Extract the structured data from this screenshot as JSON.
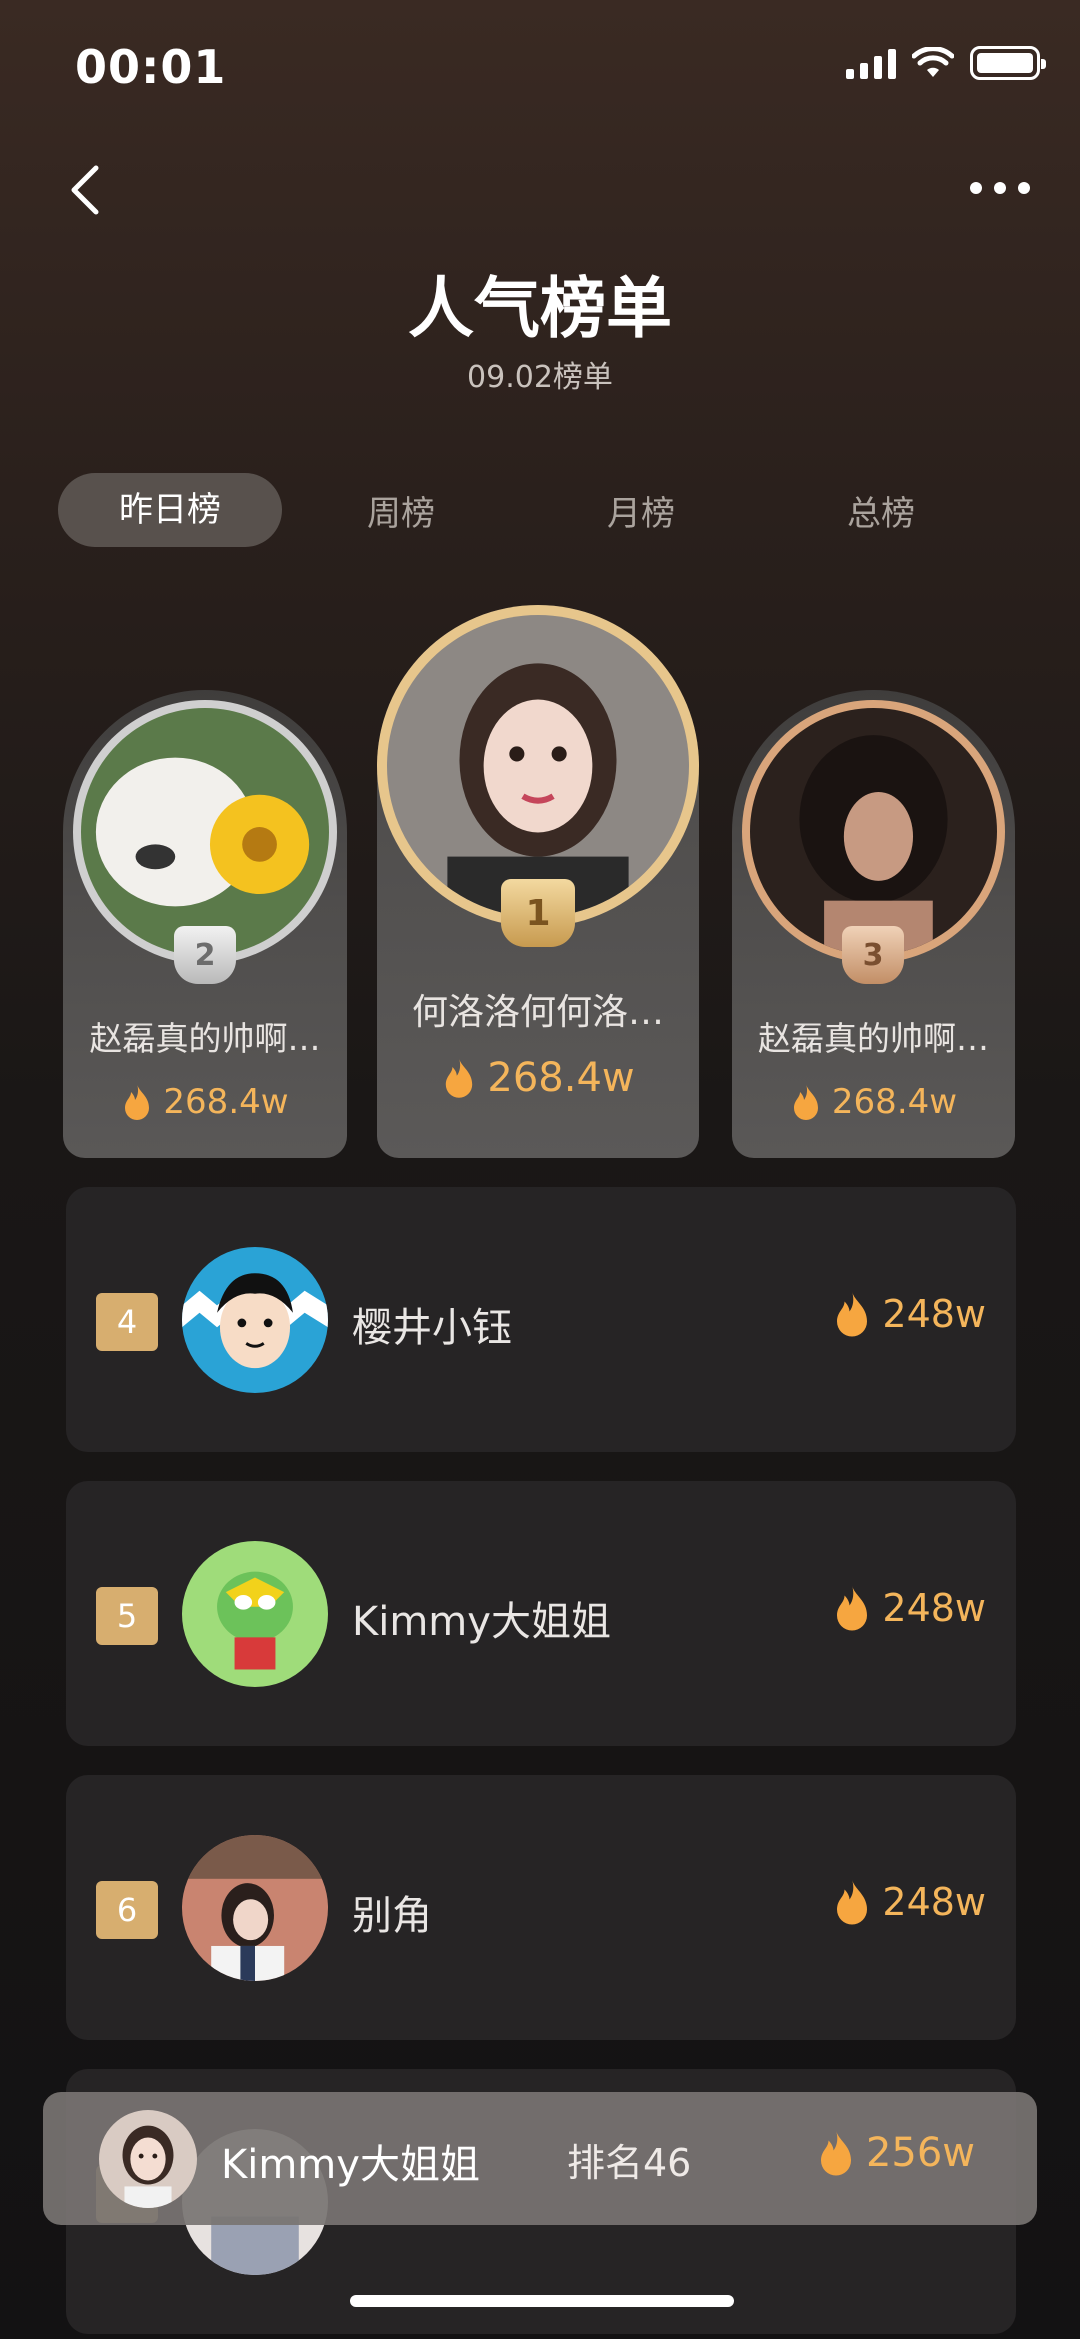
{
  "status": {
    "time": "00:01"
  },
  "header": {
    "title": "人气榜单",
    "subtitle": "09.02榜单"
  },
  "tabs": [
    {
      "label": "昨日榜",
      "active": true
    },
    {
      "label": "周榜",
      "active": false
    },
    {
      "label": "月榜",
      "active": false
    },
    {
      "label": "总榜",
      "active": false
    }
  ],
  "podium": [
    {
      "rank": "1",
      "name": "何洛洛何何洛…",
      "score": "268.4w"
    },
    {
      "rank": "2",
      "name": "赵磊真的帅啊…",
      "score": "268.4w"
    },
    {
      "rank": "3",
      "name": "赵磊真的帅啊…",
      "score": "268.4w"
    }
  ],
  "list": [
    {
      "rank": "4",
      "name": "樱井小钰",
      "score": "248w"
    },
    {
      "rank": "5",
      "name": "Kimmy大姐姐",
      "score": "248w"
    },
    {
      "rank": "6",
      "name": "别角",
      "score": "248w"
    }
  ],
  "me": {
    "name": "Kimmy大姐姐",
    "rank_text": "排名46",
    "score": "256w"
  },
  "colors": {
    "accent": "#f4b55b",
    "badge": "#d7ae6f",
    "gold_ring": "#e7c68c",
    "bronze_ring": "#d9a57b",
    "silver_ring": "#cfcfcf"
  }
}
